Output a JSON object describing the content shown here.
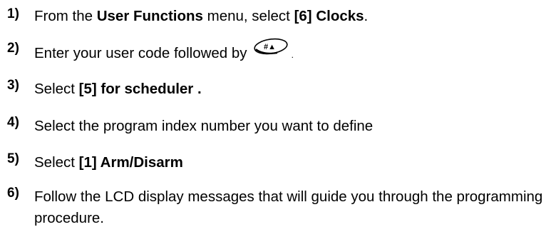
{
  "steps": [
    {
      "number": "1)",
      "parts": [
        "From the ",
        "User Functions",
        " menu, select ",
        "[6] Clocks",
        "."
      ]
    },
    {
      "number": "2)",
      "text": "Enter your user code followed by",
      "key_icon": "hash-arrow-key-icon",
      "key_label": "#▲",
      "trailing": "."
    },
    {
      "number": "3)",
      "parts": [
        "Select ",
        "[5] for scheduler ."
      ]
    },
    {
      "number": "4)",
      "text": "Select the program index number you want to define"
    },
    {
      "number": "5)",
      "parts": [
        "Select ",
        "[1] Arm/Disarm"
      ]
    },
    {
      "number": "6)",
      "text": "Follow the LCD display messages that will guide you through the programming procedure."
    }
  ]
}
